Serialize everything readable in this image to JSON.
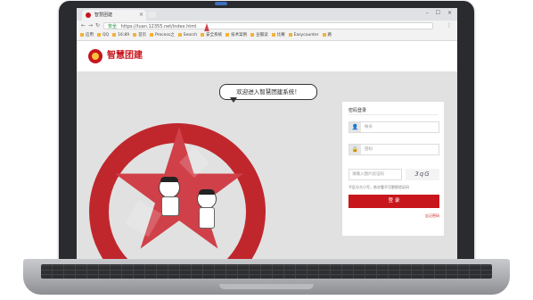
{
  "browser": {
    "tab_title": "智慧团建",
    "tab_close": "×",
    "window_controls": "–  ☐  ×",
    "url_secure_label": "安全",
    "url": "https://tuan.12355.net/index.html",
    "bookmarks": [
      "应用",
      "QQ",
      "16:89",
      "首页",
      "Process之",
      "Search",
      "安全系统",
      "技术案例",
      "豆瓣读",
      "比赛",
      "Easycounter",
      "路"
    ]
  },
  "site": {
    "name": "智慧团建"
  },
  "hero": {
    "welcome": "欢迎进入智慧团建系统！"
  },
  "login": {
    "title": "密码登录",
    "username_placeholder": "帐号",
    "password_placeholder": "密码",
    "captcha_placeholder": "请输入图片验证码",
    "captcha_text": "3qG",
    "hint": "不区分大小写，依次看不可更换验证码",
    "submit_label": "登 录",
    "forgot_label": "忘记密码"
  },
  "colors": {
    "brand_red": "#c8161d",
    "page_bg": "#e1e1e1"
  }
}
